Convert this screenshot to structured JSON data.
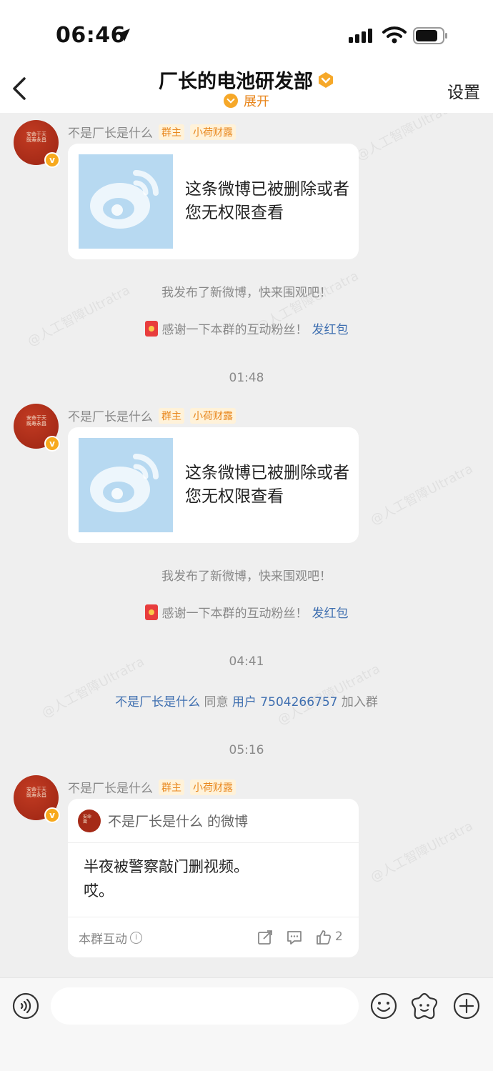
{
  "status_bar": {
    "time": "06:46"
  },
  "nav": {
    "title": "厂长的电池研发部",
    "expand_label": "展开",
    "settings_label": "设置"
  },
  "messages": [
    {
      "sender": "不是厂长是什么",
      "tags": [
        "群主",
        "小荷财露"
      ],
      "card_text": "这条微博已被删除或者您无权限查看",
      "system_text": "我发布了新微博，快来围观吧！",
      "redpacket_text": "感谢一下本群的互动粉丝！",
      "redpacket_link": "发红包"
    },
    {
      "time": "01:48",
      "sender": "不是厂长是什么",
      "tags": [
        "群主",
        "小荷财露"
      ],
      "card_text": "这条微博已被删除或者您无权限查看",
      "system_text": "我发布了新微博，快来围观吧！",
      "redpacket_text": "感谢一下本群的互动粉丝！",
      "redpacket_link": "发红包"
    }
  ],
  "join_event": {
    "time": "04:41",
    "actor": "不是厂长是什么",
    "verb": "同意",
    "target": "用户 7504266757",
    "suffix": "加入群"
  },
  "weibo_message": {
    "time": "05:16",
    "sender": "不是厂长是什么",
    "tags": [
      "群主",
      "小荷财露"
    ],
    "card_header": "不是厂长是什么 的微博",
    "body_line1": "半夜被警察敲门删视频。",
    "body_line2": "哎。",
    "footer_label": "本群互动",
    "like_count": "2"
  },
  "watermark_text": "@人工智障Ultratra",
  "colors": {
    "accent_orange": "#e8861c",
    "link_blue": "#3f6fb0",
    "background": "#efefef"
  }
}
